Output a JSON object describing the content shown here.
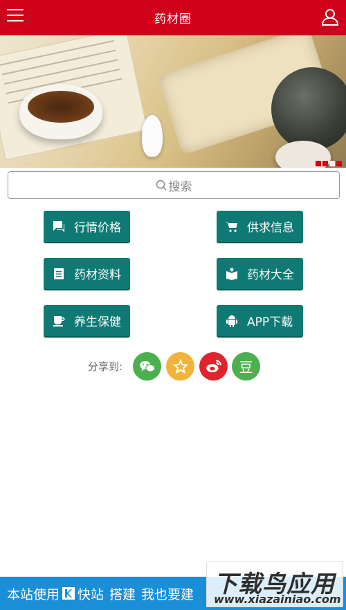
{
  "header": {
    "title": "药材圈",
    "menu_icon": "menu-icon",
    "user_icon": "user-icon",
    "color": "#d0021b"
  },
  "search": {
    "placeholder": "搜索"
  },
  "buttons": [
    {
      "label": "行情价格",
      "icon": "chat-icon"
    },
    {
      "label": "供求信息",
      "icon": "cart-icon"
    },
    {
      "label": "药材资料",
      "icon": "document-icon"
    },
    {
      "label": "药材大全",
      "icon": "book-icon"
    },
    {
      "label": "养生保健",
      "icon": "cup-icon"
    },
    {
      "label": "APP下载",
      "icon": "android-icon"
    }
  ],
  "share": {
    "label": "分享到:",
    "items": [
      {
        "name": "wechat",
        "icon": "wechat-icon",
        "color": "#4cb050"
      },
      {
        "name": "qzone",
        "icon": "star-icon",
        "color": "#f1b33a"
      },
      {
        "name": "weibo",
        "icon": "weibo-icon",
        "color": "#e0232c"
      },
      {
        "name": "douban",
        "icon": "douban-icon",
        "glyph": "豆",
        "color": "#4caf50"
      }
    ]
  },
  "footer": {
    "prefix": "本站使用",
    "brand": "快站",
    "suffix1": "搭建",
    "suffix2": "我也要建"
  },
  "watermark": {
    "line1": "下载鸟应用",
    "line2": "www.xiazainiao.com"
  },
  "colors": {
    "button": "#0e7a73",
    "footer": "#1a8ed6"
  }
}
